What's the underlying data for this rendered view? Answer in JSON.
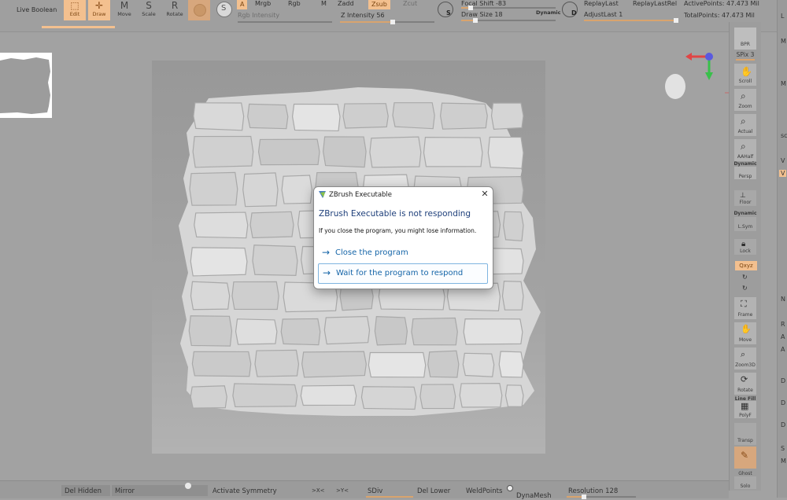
{
  "top_shelf": {
    "live_boolean": "Live Boolean",
    "tools": [
      {
        "label": "Edit",
        "icon": "edit-icon",
        "active": true
      },
      {
        "label": "Draw",
        "icon": "draw-icon",
        "active": true
      },
      {
        "label": "Move",
        "icon": "move-icon",
        "active": false
      },
      {
        "label": "Scale",
        "icon": "scale-icon",
        "active": false
      },
      {
        "label": "Rotate",
        "icon": "rotate-icon",
        "active": false
      }
    ],
    "a_button": "A",
    "mrgb": "Mrgb",
    "rgb": "Rgb",
    "m": "M",
    "rgb_intensity": "Rgb Intensity",
    "zadd": "Zadd",
    "zsub": "Zsub",
    "zcut": "Zcut",
    "z_intensity": "Z Intensity 56",
    "focal_shift": "Focal Shift -83",
    "draw_size": "Draw Size 18",
    "dynamic": "Dynamic",
    "replay_last": "ReplayLast",
    "replay_last_rel": "ReplayLastRel",
    "adjust_last": "AdjustLast 1",
    "active_points": "ActivePoints: 47.473 Mil",
    "total_points": "TotalPoints: 47.473 Mil",
    "s_letter": "S",
    "d_letter": "D",
    "z_intensity_value": 0.56,
    "focal_shift_value": 0.1,
    "draw_size_value": 0.15,
    "adjust_last_value": 1.0
  },
  "right_shelf": {
    "buttons": [
      {
        "label": "BPR",
        "icon": "bpr-icon"
      },
      {
        "label": "SPix 3",
        "icon": "spix-slider"
      },
      {
        "label": "Scroll",
        "icon": "scroll-icon"
      },
      {
        "label": "Zoom",
        "icon": "zoom-icon"
      },
      {
        "label": "Actual",
        "icon": "actual-icon"
      },
      {
        "label": "AAHalf",
        "icon": "aahalf-icon"
      },
      {
        "label": "Dynamic",
        "icon": "dynamic-label"
      },
      {
        "label": "Persp",
        "icon": "persp-icon"
      },
      {
        "label": "Floor",
        "icon": "floor-icon"
      },
      {
        "label": "Dynamic",
        "icon": "dynamic-label"
      },
      {
        "label": "L.Sym",
        "icon": "lsym-icon"
      },
      {
        "label": "Lock",
        "icon": "lock-icon"
      },
      {
        "label": "Qxyz",
        "icon": "xyz-icon"
      },
      {
        "label": "Frame",
        "icon": "frame-icon"
      },
      {
        "label": "Move",
        "icon": "move-hand-icon"
      },
      {
        "label": "Zoom3D",
        "icon": "zoom3d-icon"
      },
      {
        "label": "Rotate",
        "icon": "rotate3d-icon"
      },
      {
        "label": "Line Fill",
        "icon": "linefill-label"
      },
      {
        "label": "PolyF",
        "icon": "polyf-icon"
      },
      {
        "label": "Transp",
        "icon": "transp-icon"
      },
      {
        "label": "Ghost",
        "icon": "ghost-icon"
      },
      {
        "label": "Solo",
        "icon": "solo-icon"
      }
    ]
  },
  "right_edge": {
    "letters": [
      "L",
      "M",
      "M",
      "sc",
      "V",
      "V",
      "N",
      "R",
      "A",
      "A",
      "D",
      "D",
      "D",
      "S",
      "M"
    ]
  },
  "bottom_shelf": {
    "del_hidden": "Del Hidden",
    "mirror": "Mirror",
    "activate_symmetry": "Activate Symmetry",
    "x_lbl": ">X<",
    "y_lbl": ">Y<",
    "sdiv": "SDiv",
    "del_lower": "Del Lower",
    "weld_points": "WeldPoints",
    "dynamesh": "DynaMesh",
    "resolution": "Resolution 128",
    "resolution_value": 0.25
  },
  "dialog": {
    "title": "ZBrush Executable",
    "heading": "ZBrush Executable is not responding",
    "body": "If you close the program, you might lose information.",
    "option_close": "Close the program",
    "option_wait": "Wait for the program to respond",
    "close_glyph": "✕",
    "arrow_glyph": "→"
  },
  "colors": {
    "accent": "#f3c08f",
    "dialog_link": "#1565a8",
    "dialog_heading": "#1e3f7a",
    "ui_gray": "#a2a2a2"
  }
}
